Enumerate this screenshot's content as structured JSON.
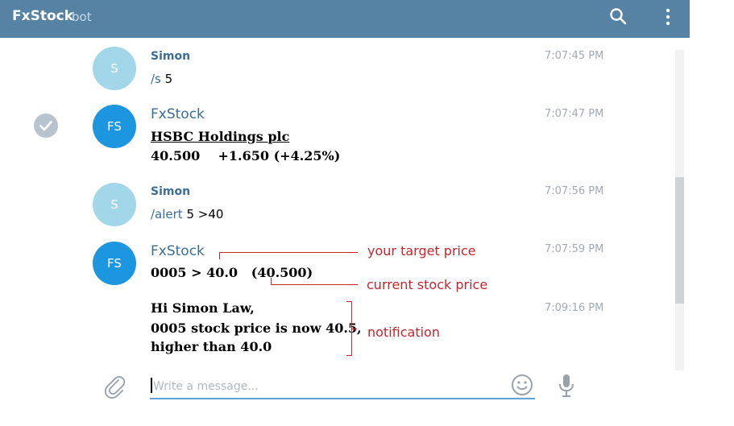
{
  "header": {
    "title": "FxStock",
    "subtitle": "bot"
  },
  "messages": [
    {
      "avatar": "S",
      "sender": "Simon",
      "time": "7:07:45 PM",
      "cmd": "/s",
      "text": " 5"
    },
    {
      "avatar": "FS",
      "sender": "FxStock",
      "time": "7:07:47 PM",
      "company": "HSBC Holdings plc",
      "price_line": "40.500    +1.650 (+4.25%)"
    },
    {
      "avatar": "S",
      "sender": "Simon",
      "time": "7:07:56 PM",
      "cmd": "/alert",
      "text": " 5 >40"
    },
    {
      "avatar": "FS",
      "sender": "FxStock",
      "time": "7:07:59 PM",
      "alert_line": "0005 > 40.0   (40.500)"
    },
    {
      "time": "7:09:16 PM",
      "lines": [
        "Hi Simon Law,",
        "0005 stock price is now 40.5,",
        "higher than 40.0"
      ]
    }
  ],
  "annotations": {
    "target": "your target price",
    "current": "current stock price",
    "notification": "notification"
  },
  "composer": {
    "placeholder": "Write a message..."
  },
  "icons": [
    "search-icon",
    "more-vert-icon",
    "check-icon",
    "attach-icon",
    "emoji-icon",
    "mic-icon"
  ],
  "colors": {
    "header": "#5682a3",
    "annotation": "#c5252d",
    "fx_avatar": "#1b96df",
    "simon_avatar": "#a2d6e9"
  }
}
